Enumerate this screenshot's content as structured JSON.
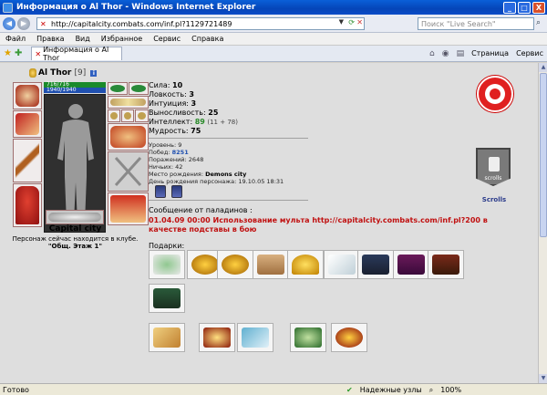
{
  "window": {
    "title": "Информация о Al Thor - Windows Internet Explorer",
    "min": "_",
    "max": "□",
    "close": "X"
  },
  "address": {
    "url": "http://capitalcity.combats.com/inf.pl?1129721489",
    "search_placeholder": "Поиск \"Live Search\""
  },
  "menu": [
    "Файл",
    "Правка",
    "Вид",
    "Избранное",
    "Сервис",
    "Справка"
  ],
  "tab": {
    "label": "Информация о Al Thor"
  },
  "commands": {
    "page": "Страница",
    "tools": "Сервис"
  },
  "character": {
    "name": "Al Thor",
    "level": "[9]",
    "hp": "716/716",
    "mp": "1940/1940",
    "city": "Capital city",
    "location_text": "Персонаж сейчас находится в клубе.",
    "location": "\"Общ. Этаж 1\"",
    "emblem_label": "scrolls",
    "emblem_name": "Scrolls"
  },
  "stats": [
    {
      "label": "Сила:",
      "value": "10"
    },
    {
      "label": "Ловкость:",
      "value": "3"
    },
    {
      "label": "Интуиция:",
      "value": "3"
    },
    {
      "label": "Выносливость:",
      "value": "25"
    },
    {
      "label": "Интеллект:",
      "value": "89",
      "extra": "(11 + 78)"
    },
    {
      "label": "Мудрость:",
      "value": "75"
    }
  ],
  "info": {
    "level": {
      "label": "Уровень:",
      "value": "9"
    },
    "wins": {
      "label": "Побед:",
      "value": "8251"
    },
    "losses": {
      "label": "Поражений:",
      "value": "2648"
    },
    "draws": {
      "label": "Ничьих:",
      "value": "42"
    },
    "birthplace": {
      "label": "Место рождения:",
      "value": "Demons city"
    },
    "birthday": {
      "label": "День рождения персонажа:",
      "value": "19.10.05 18:31"
    }
  },
  "paladin": {
    "heading": "Сообщение от паладинов :",
    "message": "01.04.09 00:00 Использование мульта http://capitalcity.combats.com/inf.pl?200 в качестве подставы в бою"
  },
  "gifts": {
    "heading": "Подарки:"
  },
  "status": {
    "left": "Готово",
    "secure": "Надежные узлы",
    "zoom": "100%"
  },
  "colors": {
    "title_bar": "#0545b8",
    "paladin_text": "#c01010",
    "clan_red": "#e02020"
  }
}
